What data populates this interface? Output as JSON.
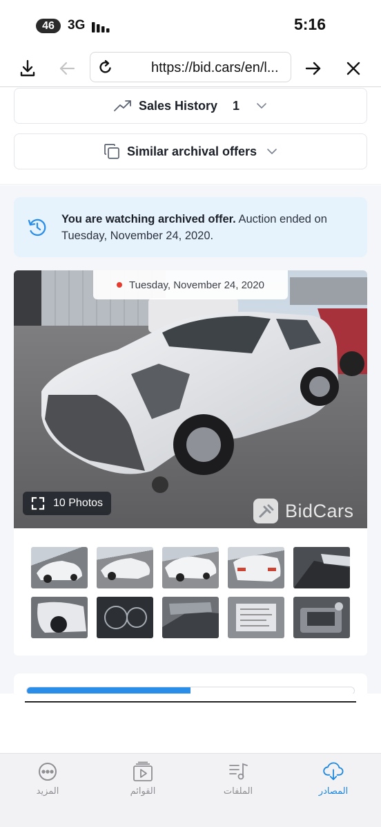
{
  "status_bar": {
    "signal_badge": "46",
    "network": "3G",
    "time": "5:16"
  },
  "browser": {
    "url": "https://bid.cars/en/l...",
    "icons": [
      "download-icon",
      "back-arrow-icon",
      "reload-icon",
      "forward-arrow-icon",
      "close-icon"
    ]
  },
  "accordions": {
    "sales_history_label": "Sales History",
    "sales_history_count": "1",
    "similar_label": "Similar archival offers"
  },
  "notice": {
    "bold_text": "You are watching archived offer.",
    "text": " Auction ended on Tuesday, November 24, 2020.",
    "accent_color": "#2a8ee8",
    "bg_color": "#e6f2fc"
  },
  "car": {
    "date": "Tuesday, November 24, 2020",
    "photos_label": "10 Photos",
    "watermark": "BidCars",
    "thumbnail_count": 10
  },
  "progress": {
    "value": 0.5,
    "color": "#2a8ee8"
  },
  "tab_bar": {
    "tabs": [
      {
        "label": "المزيد",
        "icon": "more-icon"
      },
      {
        "label": "القوائم",
        "icon": "playlist-icon"
      },
      {
        "label": "الملفات",
        "icon": "music-files-icon"
      },
      {
        "label": "المصادر",
        "icon": "cloud-download-icon"
      }
    ],
    "active_color": "#1a86e0"
  }
}
